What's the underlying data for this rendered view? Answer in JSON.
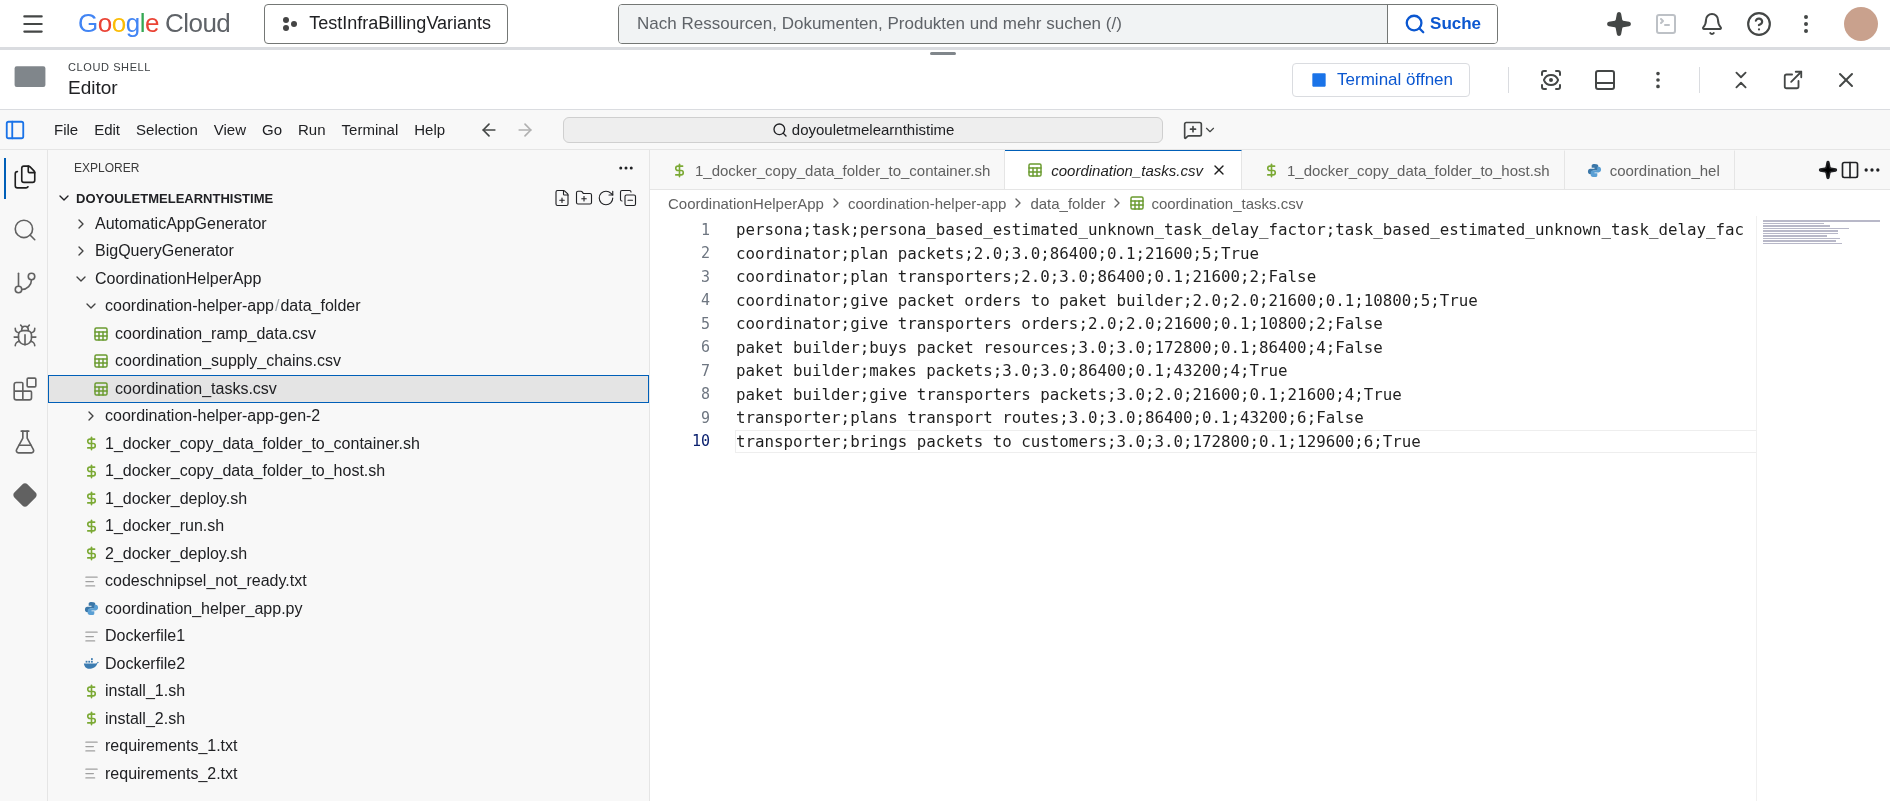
{
  "topbar": {
    "logo_word": "Google",
    "logo_product": "Cloud",
    "project": "TestInfraBillingVariants",
    "search": {
      "placeholder": "Nach Ressourcen, Dokumenten, Produkten und mehr suchen (/)"
    },
    "search_button": "Suche"
  },
  "shell_header": {
    "label": "CLOUD SHELL",
    "title": "Editor",
    "terminal_button": "Terminal öffnen"
  },
  "menu": [
    "File",
    "Edit",
    "Selection",
    "View",
    "Go",
    "Run",
    "Terminal",
    "Help"
  ],
  "command_center": "doyouletmelearnthistime",
  "activity_bar": [
    {
      "kind": "explorer",
      "selected": true
    },
    {
      "kind": "search",
      "selected": false
    },
    {
      "kind": "scm",
      "selected": false
    },
    {
      "kind": "debug",
      "selected": false
    },
    {
      "kind": "extensions",
      "selected": false
    },
    {
      "kind": "testing",
      "selected": false
    },
    {
      "kind": "cloud",
      "selected": false
    }
  ],
  "explorer": {
    "title": "EXPLORER",
    "root": "DOYOULETMELEARNTHISTIME",
    "root_expanded": true,
    "tree": [
      {
        "labels": [
          "AutomaticAppGenerator"
        ],
        "kind": "folder",
        "expanded": false,
        "selected": false
      },
      {
        "labels": [
          "BigQueryGenerator"
        ],
        "kind": "folder",
        "expanded": false,
        "selected": false
      },
      {
        "labels": [
          "CoordinationHelperApp"
        ],
        "kind": "folder",
        "expanded": true,
        "selected": false,
        "children": [
          {
            "labels": [
              "coordination-helper-app",
              "/",
              "data_folder"
            ],
            "kind": "folder",
            "expanded": true,
            "selected": false,
            "children": [
              {
                "labels": [
                  "coordination_ramp_data.csv"
                ],
                "kind": "csv",
                "selected": false
              },
              {
                "labels": [
                  "coordination_supply_chains.csv"
                ],
                "kind": "csv",
                "selected": false
              },
              {
                "labels": [
                  "coordination_tasks.csv"
                ],
                "kind": "csv",
                "selected": true
              }
            ]
          },
          {
            "labels": [
              "coordination-helper-app-gen-2"
            ],
            "kind": "folder",
            "expanded": false,
            "selected": false
          },
          {
            "labels": [
              "1_docker_copy_data_folder_to_container.sh"
            ],
            "kind": "shell",
            "selected": false
          },
          {
            "labels": [
              "1_docker_copy_data_folder_to_host.sh"
            ],
            "kind": "shell",
            "selected": false
          },
          {
            "labels": [
              "1_docker_deploy.sh"
            ],
            "kind": "shell",
            "selected": false
          },
          {
            "labels": [
              "1_docker_run.sh"
            ],
            "kind": "shell",
            "selected": false
          },
          {
            "labels": [
              "2_docker_deploy.sh"
            ],
            "kind": "shell",
            "selected": false
          },
          {
            "labels": [
              "codeschnipsel_not_ready.txt"
            ],
            "kind": "text",
            "selected": false
          },
          {
            "labels": [
              "coordination_helper_app.py"
            ],
            "kind": "python",
            "selected": false
          },
          {
            "labels": [
              "Dockerfile1"
            ],
            "kind": "text",
            "selected": false
          },
          {
            "labels": [
              "Dockerfile2"
            ],
            "kind": "docker",
            "selected": false
          },
          {
            "labels": [
              "install_1.sh"
            ],
            "kind": "shell",
            "selected": false
          },
          {
            "labels": [
              "install_2.sh"
            ],
            "kind": "shell",
            "selected": false
          },
          {
            "labels": [
              "requirements_1.txt"
            ],
            "kind": "text",
            "selected": false
          },
          {
            "labels": [
              "requirements_2.txt"
            ],
            "kind": "text",
            "selected": false
          }
        ]
      }
    ]
  },
  "tabs": [
    {
      "label": "1_docker_copy_data_folder_to_container.sh",
      "kind": "shell",
      "selected": false
    },
    {
      "label": "coordination_tasks.csv",
      "kind": "csv",
      "selected": true
    },
    {
      "label": "1_docker_copy_data_folder_to_host.sh",
      "kind": "shell",
      "selected": false
    },
    {
      "label": "coordination_hel",
      "kind": "python",
      "selected": false
    }
  ],
  "breadcrumb": [
    {
      "label": "CoordinationHelperApp",
      "kind": "folder"
    },
    {
      "label": "coordination-helper-app",
      "kind": "folder"
    },
    {
      "label": "data_folder",
      "kind": "folder"
    },
    {
      "label": "coordination_tasks.csv",
      "kind": "csv"
    }
  ],
  "code_lines": [
    {
      "number": "1",
      "text": "persona;task;persona_based_estimated_unknown_task_delay_factor;task_based_estimated_unknown_task_delay_fac",
      "current": false
    },
    {
      "number": "2",
      "text": "coordinator;plan packets;2.0;3.0;86400;0.1;21600;5;True",
      "current": false
    },
    {
      "number": "3",
      "text": "coordinator;plan transporters;2.0;3.0;86400;0.1;21600;2;False",
      "current": false
    },
    {
      "number": "4",
      "text": "coordinator;give packet orders to paket builder;2.0;2.0;21600;0.1;10800;5;True",
      "current": false
    },
    {
      "number": "5",
      "text": "coordinator;give transporters orders;2.0;2.0;21600;0.1;10800;2;False",
      "current": false
    },
    {
      "number": "6",
      "text": "paket builder;buys packet resources;3.0;3.0;172800;0.1;86400;4;False",
      "current": false
    },
    {
      "number": "7",
      "text": "paket builder;makes packets;3.0;3.0;86400;0.1;43200;4;True",
      "current": false
    },
    {
      "number": "8",
      "text": "paket builder;give transporters packets;3.0;2.0;21600;0.1;21600;4;True",
      "current": false
    },
    {
      "number": "9",
      "text": "transporter;plans transport routes;3.0;3.0;86400;0.1;43200;6;False",
      "current": false
    },
    {
      "number": "10",
      "text": "transporter;brings packets to customers;3.0;3.0;172800;0.1;129600;6;True",
      "current": true
    }
  ]
}
